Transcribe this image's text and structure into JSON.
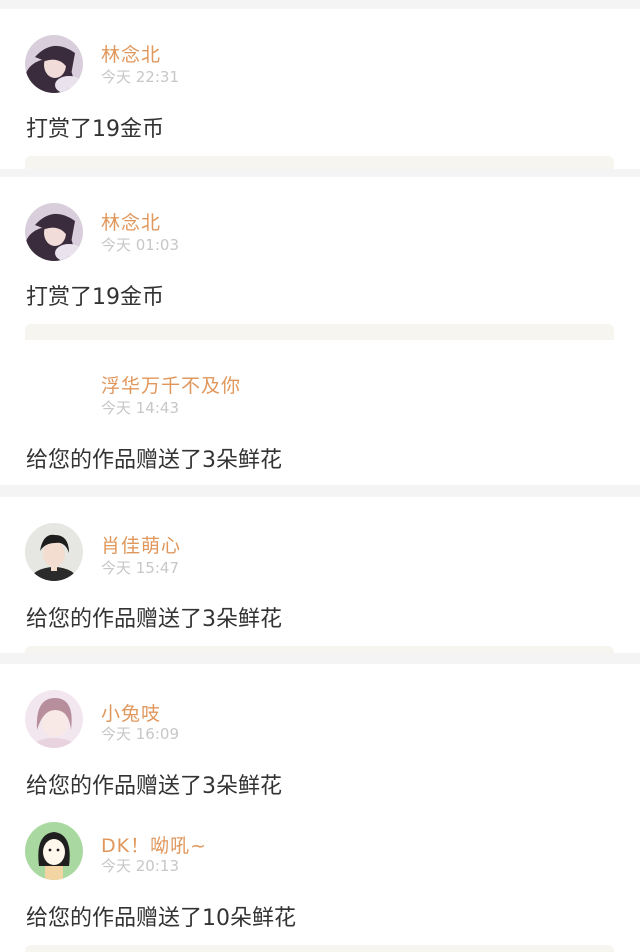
{
  "colors": {
    "name": "#e0975c",
    "time": "#c7c7c7",
    "message": "#333333",
    "page_bg": "#f4f4f4"
  },
  "items": [
    {
      "name": "林念北",
      "time": "今天 22:31",
      "message": "打赏了19金币",
      "avatar": "girl-dark-hair-avatar"
    },
    {
      "name": "林念北",
      "time": "今天 01:03",
      "message": "打赏了19金币",
      "avatar": "girl-dark-hair-avatar"
    },
    {
      "name": "浮华万千不及你",
      "time": "今天 14:43",
      "message": "给您的作品赠送了3朵鲜花",
      "avatar": ""
    },
    {
      "name": "肖佳萌心",
      "time": "今天 15:47",
      "message": "给您的作品赠送了3朵鲜花",
      "avatar": "boy-avatar"
    },
    {
      "name": "小兔吱",
      "time": "今天 16:09",
      "message": "给您的作品赠送了3朵鲜花",
      "avatar": "pink-girl-avatar"
    },
    {
      "name": "DK！呦吼~",
      "time": "今天 20:13",
      "message": "给您的作品赠送了10朵鲜花",
      "avatar": "cartoon-girl-avatar"
    }
  ]
}
